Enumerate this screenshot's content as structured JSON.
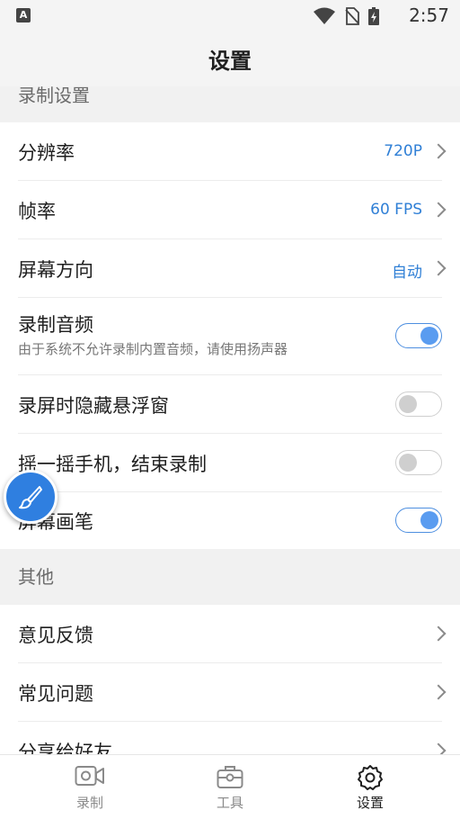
{
  "status_bar": {
    "time": "2:57",
    "notification_glyph": "A"
  },
  "header": {
    "title": "设置"
  },
  "sections": {
    "record": {
      "title": "录制设置"
    },
    "other": {
      "title": "其他"
    }
  },
  "settings": {
    "resolution": {
      "label": "分辨率",
      "value": "720P"
    },
    "framerate": {
      "label": "帧率",
      "value": "60 FPS"
    },
    "orientation": {
      "label": "屏幕方向",
      "value": "自动"
    },
    "record_audio": {
      "label": "录制音频",
      "sub": "由于系统不允许录制内置音频，请使用扬声器",
      "on": true
    },
    "hide_float": {
      "label": "录屏时隐藏悬浮窗",
      "on": false
    },
    "shake_stop": {
      "label": "摇一摇手机，结束录制",
      "on": false
    },
    "screen_brush": {
      "label": "屏幕画笔",
      "on": true
    },
    "feedback": {
      "label": "意见反馈"
    },
    "faq": {
      "label": "常见问题"
    },
    "share": {
      "label": "分享给好友"
    }
  },
  "bottom_nav": {
    "record": {
      "label": "录制",
      "icon": "video-camera-icon"
    },
    "tools": {
      "label": "工具",
      "icon": "toolbox-icon"
    },
    "settings": {
      "label": "设置",
      "icon": "gear-icon"
    }
  },
  "colors": {
    "accent": "#2f7fd6",
    "toggle_on": "#5a9cf0",
    "section_bg": "#f1f1f1"
  }
}
